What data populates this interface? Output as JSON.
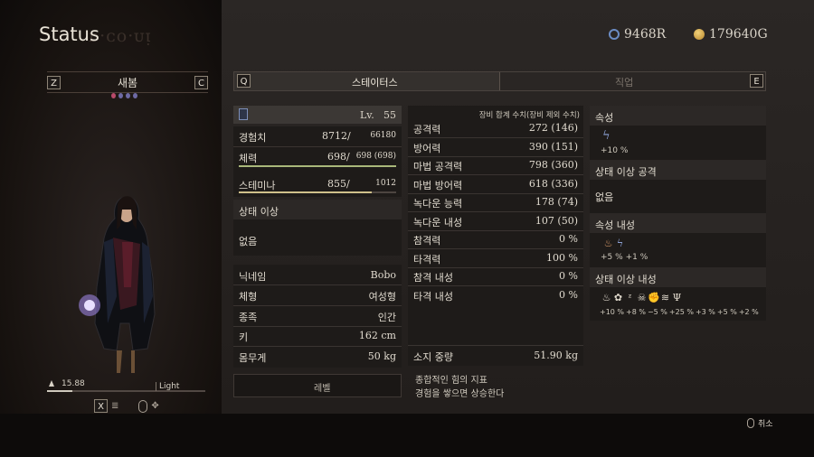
{
  "header": {
    "title": "Status",
    "title_shadow": "ᴅ·ᴄᴏ·ᴜᴉ",
    "rift_crystals": "9468R",
    "gold": "179640G"
  },
  "character": {
    "name": "새봄",
    "key_left": "Z",
    "key_right": "C",
    "weight_value": "15.88",
    "weight_label": "Light",
    "weight_fraction": 0.16,
    "control_key": "X"
  },
  "tabs": {
    "key_left": "Q",
    "key_right": "E",
    "items": [
      {
        "label": "스테이터스",
        "active": true
      },
      {
        "label": "직업",
        "active": false
      }
    ]
  },
  "basic": {
    "level_label": "Lv.",
    "level": "55",
    "stats": [
      {
        "label": "경험치",
        "current": "8712/",
        "max": "66180"
      },
      {
        "label": "체력",
        "current": "698/",
        "max": "698 (698)",
        "fill": 1.0
      },
      {
        "label": "스테미나",
        "current": "855/",
        "max": "1012",
        "fill": 0.845
      }
    ]
  },
  "status_ailment": {
    "title": "상태 이상",
    "value": "없음"
  },
  "profile": [
    {
      "label": "닉네임",
      "value": "Bobo"
    },
    {
      "label": "체형",
      "value": "여성형"
    },
    {
      "label": "종족",
      "value": "인간"
    },
    {
      "label": "키",
      "value": "162 cm"
    },
    {
      "label": "몸무게",
      "value": "50 kg"
    }
  ],
  "combat": {
    "header": "장비 합계 수치(장비 제외 수치)",
    "stats": [
      {
        "label": "공격력",
        "value": "272 (146)"
      },
      {
        "label": "방어력",
        "value": "390 (151)"
      },
      {
        "label": "마법 공격력",
        "value": "798 (360)"
      },
      {
        "label": "마법 방어력",
        "value": "618 (336)"
      },
      {
        "label": "녹다운 능력",
        "value": "178 (74)"
      },
      {
        "label": "녹다운 내성",
        "value": "107 (50)"
      },
      {
        "label": "참격력",
        "value": "0 %"
      },
      {
        "label": "타격력",
        "value": "100 %"
      },
      {
        "label": "참격 내성",
        "value": "0 %"
      },
      {
        "label": "타격 내성",
        "value": "0 %"
      }
    ],
    "carry_label": "소지 중량",
    "carry_value": "51.90 kg"
  },
  "affinities": {
    "element_title": "속성",
    "element_values": [
      "+10 %"
    ],
    "ailment_attack_title": "상태 이상 공격",
    "ailment_attack_value": "없음",
    "element_resist_title": "속성 내성",
    "element_resist_values": [
      "+5 %",
      "+1 %"
    ],
    "ailment_resist_title": "상태 이상 내성",
    "ailment_resist_values": [
      "+10 %",
      "+8 %",
      "−5 %",
      "+25 %",
      "+3 %",
      "+5 %",
      "+2 %"
    ],
    "ailment_icons": [
      "fire-icon",
      "poison-icon",
      "sleep-icon",
      "skull-icon",
      "fist-icon",
      "wind-icon",
      "torch-icon"
    ]
  },
  "footer": {
    "level_button": "레벨",
    "description_line1": "종합적인 힘의 지표",
    "description_line2": "경험을 쌓으면 상승한다",
    "cancel_label": "취소"
  }
}
